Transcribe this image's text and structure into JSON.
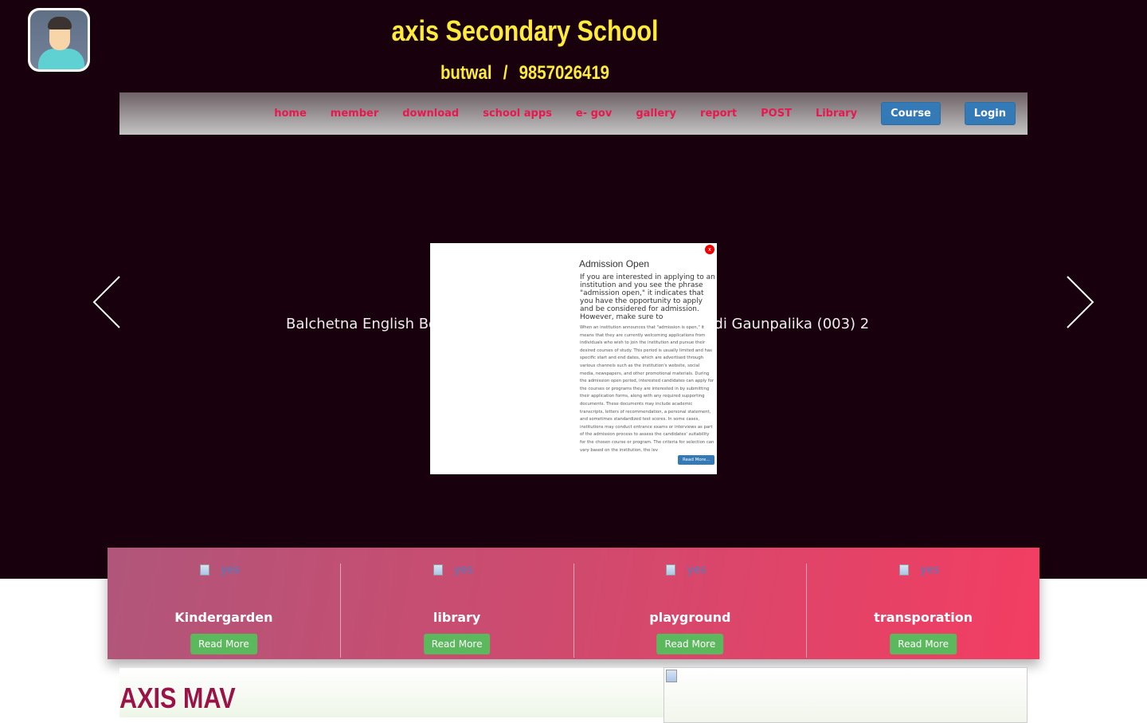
{
  "header": {
    "school_name": "axis Secondary School",
    "location": "butwal",
    "separator": "/",
    "phone": "9857026419"
  },
  "nav": {
    "items": [
      "home",
      "member",
      "download",
      "school apps",
      "e- gov",
      "gallery",
      "report",
      "POST",
      "Library"
    ],
    "course_label": "Course",
    "login_label": "Login"
  },
  "slider": {
    "text_left": "Balchetna English Bo",
    "text_right": "ndi Gaunpalika (003) 2"
  },
  "modal": {
    "close_label": "x",
    "title": "Admission Open",
    "lead": "If you are interested in applying to an institution and you see the phrase \"admission open,\" it indicates that you have the opportunity to apply and be considered for admission. However, make sure to",
    "body": "When an institution announces that \"admission is open,\" it means that they are currently welcoming applications from individuals who wish to join the institution and pursue their desired courses of study. This period is usually limited and has specific start and end dates, which are advertised through various channels such as the institution's website, social media, newspapers, and other promotional materials. During the admission open period, interested candidates can apply for the courses or programs they are interested in by submitting their application forms, along with any required supporting documents. These documents may include academic transcripts, letters of recommendation, a personal statement, and sometimes standardized test scores. In some cases, institutions may conduct entrance exams or interviews as part of the admission process to assess the candidates' suitability for the chosen course or program. The criteria for selection can vary based on the institution, the lev",
    "read_more": "Read More..."
  },
  "services": [
    {
      "img_alt": "yes",
      "name": "Kindergarden",
      "button": "Read More"
    },
    {
      "img_alt": "yes",
      "name": "library",
      "button": "Read More"
    },
    {
      "img_alt": "yes",
      "name": "playground",
      "button": "Read More"
    },
    {
      "img_alt": "yes",
      "name": "transporation",
      "button": "Read More"
    }
  ],
  "about": {
    "heading": "AXIS MAV"
  }
}
